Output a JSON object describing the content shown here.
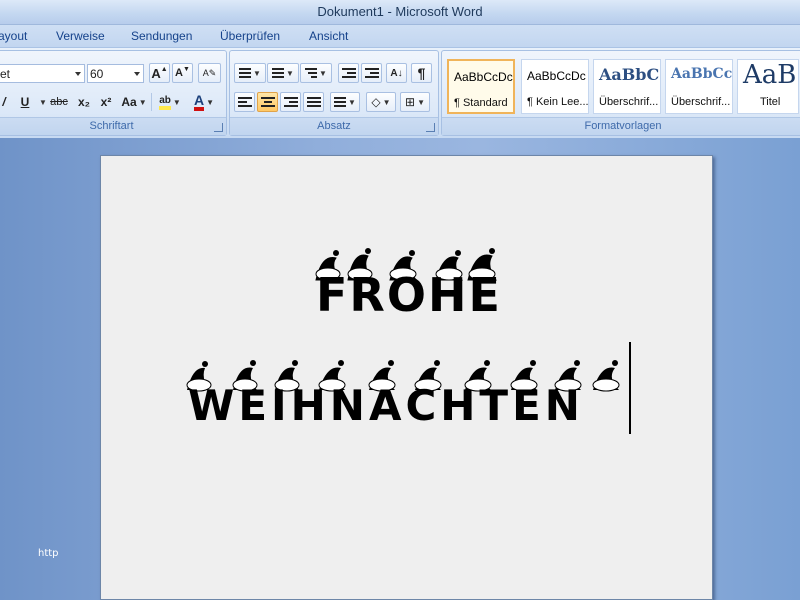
{
  "window": {
    "title": "Dokument1 - Microsoft Word"
  },
  "tabs": [
    "ayout",
    "Verweise",
    "Sendungen",
    "Überprüfen",
    "Ansicht"
  ],
  "ribbon": {
    "font": {
      "family_value": "et",
      "size_value": "60",
      "grow_label": "A",
      "shrink_label": "A",
      "bold_label": "/",
      "underline_label": "U",
      "strike_label": "abc",
      "subscript_label": "x₂",
      "superscript_label": "x²",
      "case_label": "Aa",
      "highlight_label": "ab",
      "color_label": "A",
      "group_label": "Schriftart"
    },
    "paragraph": {
      "pilcrow_label": "¶",
      "group_label": "Absatz"
    },
    "styles": {
      "items": [
        {
          "sample": "AaBbCcDc",
          "name": "¶ Standard"
        },
        {
          "sample": "AaBbCcDc",
          "name": "¶ Kein Lee..."
        },
        {
          "sample": "AaBbC",
          "name": "Überschrif..."
        },
        {
          "sample": "AaBbCc",
          "name": "Überschrif..."
        },
        {
          "sample": "AaB",
          "name": "Titel"
        }
      ],
      "group_label": "Formatvorlagen"
    }
  },
  "document": {
    "line1": "FROHE",
    "line2": "WEIHNACHTEN"
  },
  "watermark": "http",
  "colors": {
    "ribbon_label": "#3e6aaa",
    "tab_text": "#15428b",
    "highlight_yellow": "#ffe84c",
    "font_color_red": "#d01010",
    "selected_border": "#f0b45a"
  }
}
